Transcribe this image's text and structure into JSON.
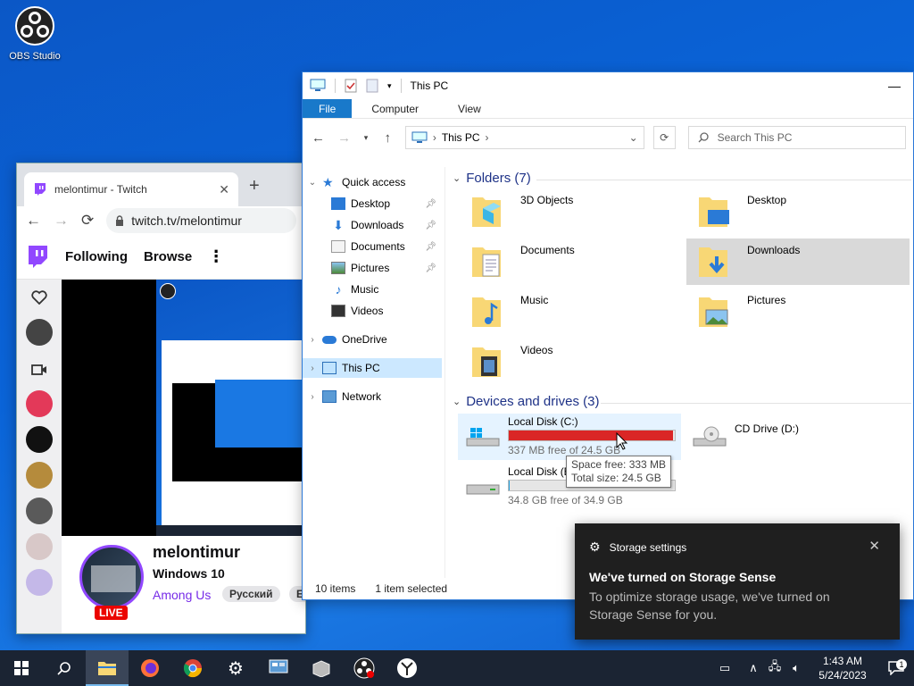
{
  "desktop": {
    "obs_label": "OBS Studio"
  },
  "browser": {
    "tab_title": "melontimur - Twitch",
    "url": "twitch.tv/melontimur",
    "nav_following": "Following",
    "nav_browse": "Browse",
    "channel_name": "melontimur",
    "game": "Windows 10",
    "category": "Among Us",
    "tags": [
      "Русский",
      "English"
    ],
    "live_badge": "LIVE"
  },
  "explorer": {
    "title": "This PC",
    "ribbon_tabs": [
      "File",
      "Computer",
      "View"
    ],
    "breadcrumb": "This PC",
    "search_placeholder": "Search This PC",
    "nav": {
      "quick_access": "Quick access",
      "desktop": "Desktop",
      "downloads": "Downloads",
      "documents": "Documents",
      "pictures": "Pictures",
      "music": "Music",
      "videos": "Videos",
      "onedrive": "OneDrive",
      "this_pc": "This PC",
      "network": "Network"
    },
    "folders_header": "Folders (7)",
    "folders": [
      "3D Objects",
      "Desktop",
      "Documents",
      "Downloads",
      "Music",
      "Pictures",
      "Videos"
    ],
    "drives_header": "Devices and drives (3)",
    "drives": [
      {
        "name": "Local Disk (C:)",
        "free": "337 MB free of 24.5 GB",
        "used_fraction": 0.987,
        "color": "#da2626"
      },
      {
        "name": "Local Disk (E:)",
        "free": "34.8 GB free of 34.9 GB",
        "used_fraction": 0.003,
        "color": "#26a0da"
      },
      {
        "name": "CD Drive (D:)"
      }
    ],
    "tooltip_free": "Space free: 333 MB",
    "tooltip_total": "Total size: 24.5 GB",
    "status_items": "10 items",
    "status_selected": "1 item selected"
  },
  "toast": {
    "app": "Storage settings",
    "heading": "We've turned on Storage Sense",
    "body": "To optimize storage usage, we've turned on Storage Sense for you."
  },
  "taskbar": {
    "time": "1:43 AM",
    "date": "5/24/2023",
    "notification_count": "1"
  },
  "colors": {
    "accent": "#1979ca",
    "twitch": "#9147ff",
    "live": "#eb0400"
  }
}
